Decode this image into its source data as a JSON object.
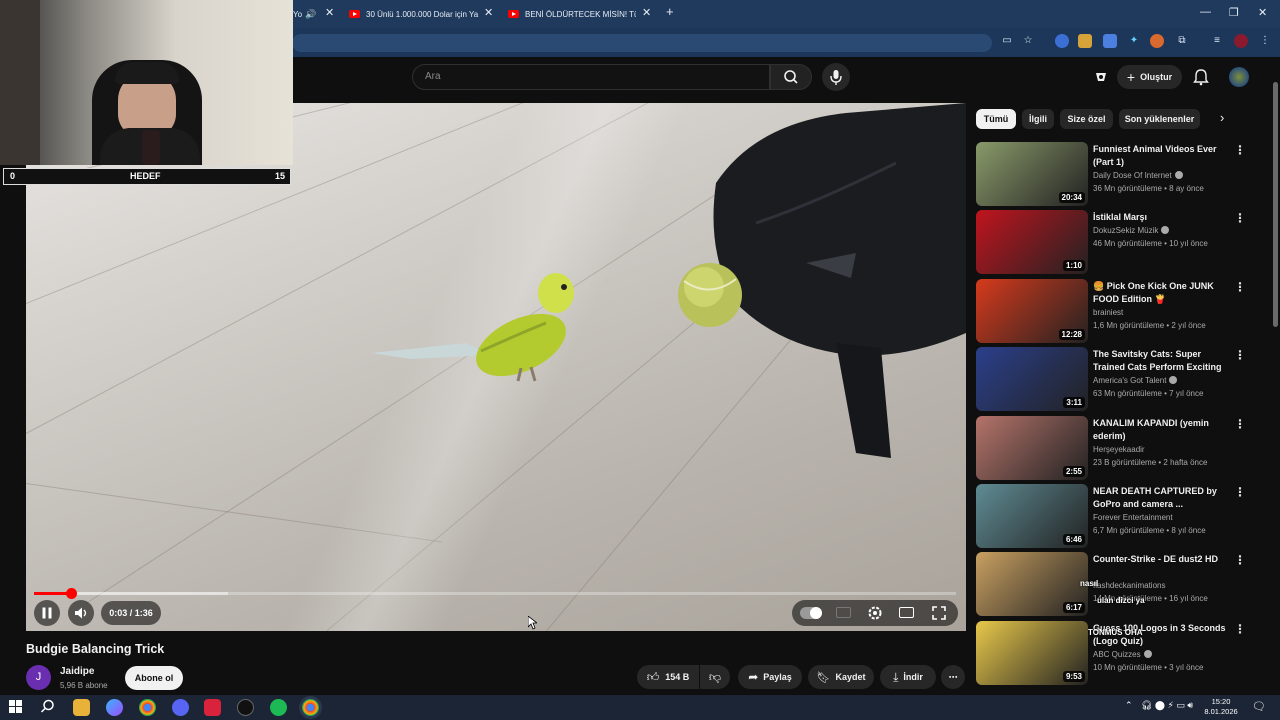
{
  "browser": {
    "tabs": [
      {
        "title": "Yo"
      },
      {
        "title": "30 Ünlü 1.000.000 Dolar için Ya"
      },
      {
        "title": "BENİ ÖLDÜRTECEK MİSİN! Türk"
      }
    ],
    "new_tab": "+",
    "close_glyph": "✕",
    "window_controls": {
      "minimize": "—",
      "restore": "❐",
      "close": "✕"
    }
  },
  "header": {
    "search_placeholder": "Ara",
    "create_label": "Oluştur"
  },
  "overlay": {
    "goal_left": "0",
    "goal_label": "HEDEF",
    "goal_right": "15"
  },
  "player": {
    "time": "0:03 / 1:36",
    "progress_fraction": 0.04,
    "buffer_fraction": 0.21
  },
  "video": {
    "title": "Budgie Balancing Trick",
    "channel_initial": "J",
    "channel_name": "Jaidipe",
    "subscribers": "5,96 B abone",
    "subscribe_label": "Abone ol",
    "likes": "154 B",
    "share_label": "Paylaş",
    "save_label": "Kaydet",
    "download_label": "İndir"
  },
  "sidebar": {
    "chips": [
      "Tümü",
      "İlgili",
      "Size özel",
      "Son yüklenenler"
    ],
    "recommendations": [
      {
        "title": "Funniest Animal Videos Ever (Part 1)",
        "channel": "Daily Dose Of Internet",
        "verified": true,
        "meta": "36 Mn görüntüleme • 8 ay önce",
        "duration": "20:34",
        "thumb": "#8a9a6a"
      },
      {
        "title": "İstiklal Marşı",
        "channel": "DokuzSekiz Müzik",
        "verified": true,
        "meta": "46 Mn görüntüleme • 10 yıl önce",
        "duration": "1:10",
        "thumb": "#c0141e"
      },
      {
        "title": "🍔 Pick One Kick One JUNK FOOD Edition 🍟",
        "channel": "brainiest",
        "verified": false,
        "meta": "1,6 Mn görüntüleme • 2 yıl önce",
        "duration": "12:28",
        "thumb": "#d63a1c"
      },
      {
        "title": "The Savitsky Cats: Super Trained Cats Perform Exciting ...",
        "channel": "America's Got Talent",
        "verified": true,
        "meta": "63 Mn görüntüleme • 7 yıl önce",
        "duration": "3:11",
        "thumb": "#2b3f8c"
      },
      {
        "title": "KANALIM KAPANDI (yemin ederim)",
        "channel": "Herşeyekaadir",
        "verified": false,
        "meta": "23 B görüntüleme • 2 hafta önce",
        "duration": "2:55",
        "thumb": "#b5746a"
      },
      {
        "title": "NEAR DEATH CAPTURED by GoPro and camera ...",
        "channel": "Forever Entertainment",
        "verified": false,
        "meta": "6,7 Mn görüntüleme • 8 yıl önce",
        "duration": "6:46",
        "thumb": "#5f8c94"
      },
      {
        "title": "Counter-Strike - DE dust2 HD",
        "channel": "flashdeckanimations",
        "verified": false,
        "meta": "14 Mn görüntüleme • 16 yıl önce",
        "duration": "6:17",
        "thumb": "#c9a061"
      },
      {
        "title": "Guess 100 Logos in 3 Seconds (Logo Quiz)",
        "channel": "ABC Quizzes",
        "verified": true,
        "meta": "10 Mn görüntüleme • 3 yıl önce",
        "duration": "9:53",
        "thumb": "#e8c84a"
      }
    ]
  },
  "chat_overlay": {
    "line1": "nasıl",
    "line2": "ulan dizci ya",
    "line3": "TONMUS OHA"
  },
  "taskbar": {
    "time": "15:20",
    "date": "8.01.2026"
  }
}
